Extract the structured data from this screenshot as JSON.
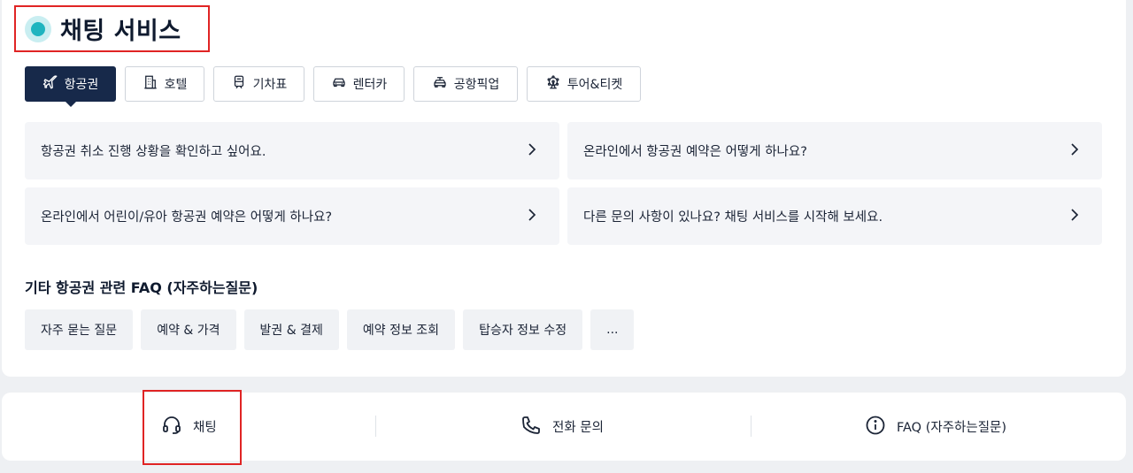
{
  "header": {
    "title": "채팅 서비스"
  },
  "tabs": [
    {
      "label": "항공권",
      "icon": "airplane-icon",
      "active": true
    },
    {
      "label": "호텔",
      "icon": "building-icon",
      "active": false
    },
    {
      "label": "기차표",
      "icon": "train-icon",
      "active": false
    },
    {
      "label": "렌터카",
      "icon": "car-icon",
      "active": false
    },
    {
      "label": "공항픽업",
      "icon": "pickup-car-icon",
      "active": false
    },
    {
      "label": "투어&티켓",
      "icon": "ferris-wheel-icon",
      "active": false
    }
  ],
  "questions": [
    {
      "text": "항공권 취소 진행 상황을 확인하고 싶어요."
    },
    {
      "text": "온라인에서 항공권 예약은 어떻게 하나요?"
    },
    {
      "text": "온라인에서 어린이/유아 항공권 예약은 어떻게 하나요?"
    },
    {
      "text": "다른 문의 사항이 있나요? 채팅 서비스를 시작해 보세요."
    }
  ],
  "faq": {
    "title": "기타 항공권 관련 FAQ (자주하는질문)",
    "chips": [
      "자주 묻는 질문",
      "예약 & 가격",
      "발권 & 결제",
      "예약 정보 조회",
      "탑승자 정보 수정",
      "..."
    ]
  },
  "bottom": {
    "chat_label": "채팅",
    "phone_label": "전화 문의",
    "faq_label": "FAQ (자주하는질문)"
  },
  "colors": {
    "accent": "#1fb4bf",
    "active_tab": "#17294a",
    "highlight": "#e02424"
  }
}
